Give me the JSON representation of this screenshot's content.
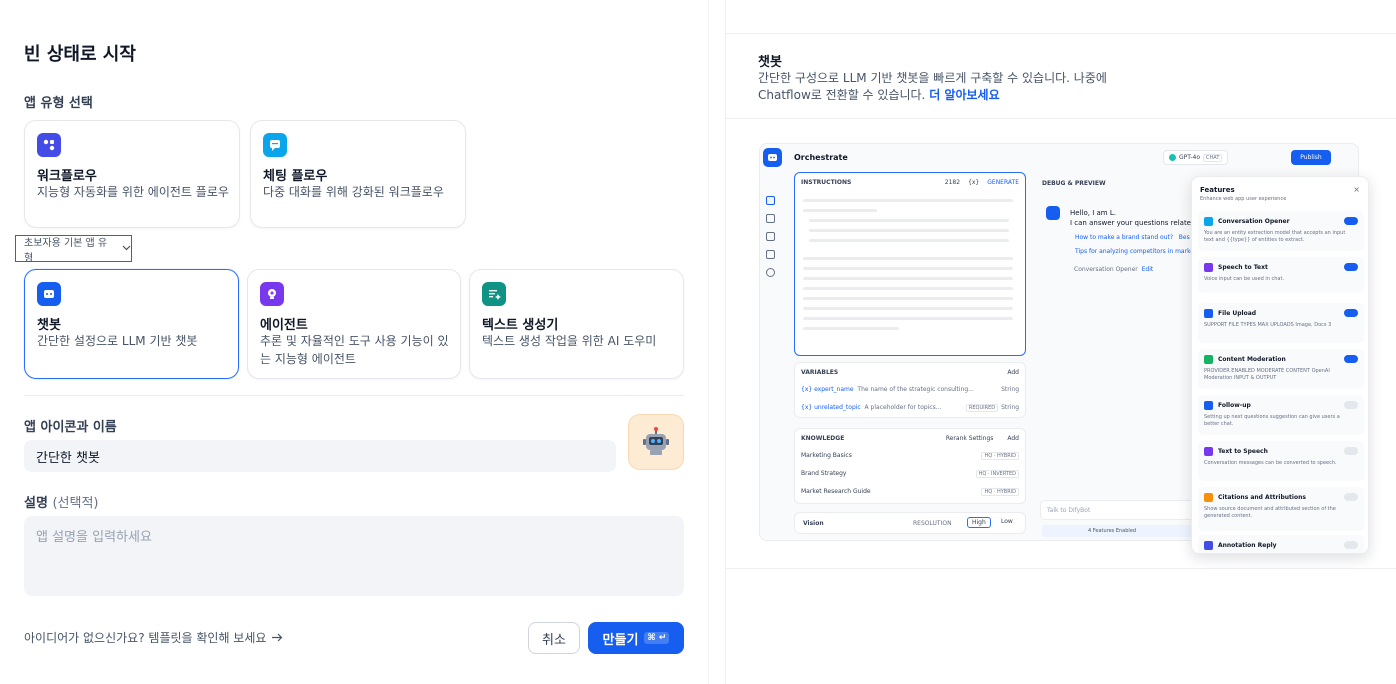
{
  "page_title": "빈 상태로 시작",
  "app_type_section": "앱 유형 선택",
  "top_cards": [
    {
      "title": "워크플로우",
      "desc": "지능형 자동화를 위한 에이전트 플로우",
      "color": "#444ce7"
    },
    {
      "title": "체팅 플로우",
      "desc": "다중 대화를 위해 강화된 워크플로우",
      "color": "#0ba5ec"
    }
  ],
  "beginner_toggle": "초보자용 기본 앱 유형",
  "bottom_cards": [
    {
      "title": "챗봇",
      "desc": "간단한 설정으로 LLM 기반 챗봇",
      "color": "#155eef",
      "selected": true
    },
    {
      "title": "에이전트",
      "desc": "추론 및 자율적인 도구 사용 기능이 있는 지능형 에이전트",
      "color": "#7839ee",
      "selected": false
    },
    {
      "title": "텍스트 생성기",
      "desc": "텍스트 생성 작업을 위한 AI 도우미",
      "color": "#0e9384",
      "selected": false
    }
  ],
  "icon_name_label": "앱 아이콘과 이름",
  "app_name_value": "간단한 챗봇",
  "app_icon": "robot-icon",
  "description_label": "설명",
  "description_optional": "(선택적)",
  "description_placeholder": "앱 설명을 입력하세요",
  "template_link": "아이디어가 없으신가요? 템플릿을 확인해 보세요",
  "cancel_label": "취소",
  "create_label": "만들기",
  "create_shortcut": "⌘ ↵",
  "preview": {
    "title": "챗봇",
    "desc": "간단한 구성으로 LLM 기반 챗봇을 빠르게 구축할 수 있습니다. 나중에 Chatflow로 전환할 수 있습니다.",
    "learn_more": "더 알아보세요",
    "mock": {
      "orchestrate": "Orchestrate",
      "model": "GPT-4o",
      "model_tag": "CHAT",
      "publish": "Publish",
      "instructions": "INSTRUCTIONS",
      "instr_count": "2182",
      "instr_var": "{x}",
      "generate": "GENERATE",
      "debug": "DEBUG & PREVIEW",
      "chat_line1": "Hello, I am L.",
      "chat_line2": "I can answer your questions related",
      "q1": "How to make a brand stand out?",
      "q1b": "Bes",
      "q2": "Tips for analyzing competitors in marke",
      "opener": "Conversation Opener",
      "opener_edit": "Edit",
      "variables": "VARIABLES",
      "add": "Add",
      "vars": [
        {
          "name": "{x} expert_name",
          "hint": "The name of the strategic consulting...",
          "type": "String"
        },
        {
          "name": "{x} unrelated_topic",
          "hint": "A placeholder for topics...",
          "req": "REQUIRED",
          "type": "String"
        }
      ],
      "knowledge": "KNOWLEDGE",
      "rerank": "Rerank Settings",
      "kb": [
        {
          "name": "Marketing Basics",
          "tag": "HQ · HYBRID"
        },
        {
          "name": "Brand Strategy",
          "tag": "HQ · INVERTED"
        },
        {
          "name": "Market Research Guide",
          "tag": "HQ · HYBRID"
        }
      ],
      "vision": "Vision",
      "resolution": "RESOLUTION",
      "high": "High",
      "low": "Low",
      "talk": "Talk to DifyBot",
      "features_enabled": "4 Features Enabled",
      "features_title": "Features",
      "features_sub": "Enhance web app user experience",
      "features": [
        {
          "title": "Conversation Opener",
          "desc": "You are an entity extraction model that accepts an input text and {{type}} of entities to extract.",
          "on": true,
          "color": "#0ba5ec"
        },
        {
          "title": "Speech to Text",
          "desc": "Voice input can be used in chat.",
          "on": true,
          "color": "#7839ee"
        },
        {
          "title": "File Upload",
          "desc": "SUPPORT FILE TYPES  MAX UPLOADS  Image, Docs  3",
          "on": true,
          "color": "#155eef"
        },
        {
          "title": "Content Moderation",
          "desc": "PROVIDER  ENABLED MODERATE CONTENT  OpenAI Moderation  INPUT & OUTPUT",
          "on": true,
          "color": "#16b364"
        },
        {
          "title": "Follow-up",
          "desc": "Setting up next questions suggestion can give users a better chat.",
          "on": false,
          "color": "#155eef"
        },
        {
          "title": "Text to Speech",
          "desc": "Conversation messages can be converted to speech.",
          "on": false,
          "color": "#7839ee"
        },
        {
          "title": "Citations and Attributions",
          "desc": "Show source document and attributed section of the generated content.",
          "on": false,
          "color": "#f79009"
        },
        {
          "title": "Annotation Reply",
          "desc": "",
          "on": false,
          "color": "#444ce7"
        }
      ]
    }
  }
}
